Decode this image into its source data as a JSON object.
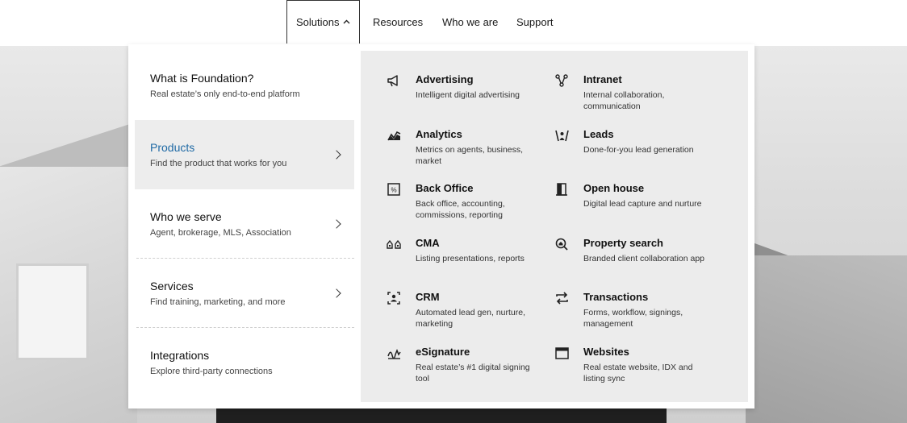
{
  "topnav": {
    "items": [
      {
        "label": "Solutions",
        "active": true
      },
      {
        "label": "Resources"
      },
      {
        "label": "Who we are"
      },
      {
        "label": "Support"
      }
    ]
  },
  "left": {
    "items": [
      {
        "title": "What is Foundation?",
        "subtitle": "Real estate’s only end-to-end platform",
        "arrow": false,
        "selected": false
      },
      {
        "title": "Products",
        "subtitle": "Find the product that works for you",
        "arrow": true,
        "selected": true
      },
      {
        "title": "Who we serve",
        "subtitle": "Agent, brokerage, MLS, Association",
        "arrow": true,
        "selected": false
      },
      {
        "title": "Services",
        "subtitle": "Find training, marketing, and more",
        "arrow": true,
        "selected": false
      },
      {
        "title": "Integrations",
        "subtitle": "Explore third-party connections",
        "arrow": false,
        "selected": false
      }
    ]
  },
  "products": [
    {
      "icon": "megaphone-icon",
      "title": "Advertising",
      "desc": "Intelligent digital advertising"
    },
    {
      "icon": "network-icon",
      "title": "Intranet",
      "desc": "Internal collaboration, communication"
    },
    {
      "icon": "analytics-icon",
      "title": "Analytics",
      "desc": "Metrics on agents, business, market"
    },
    {
      "icon": "leads-icon",
      "title": "Leads",
      "desc": "Done-for-you lead generation"
    },
    {
      "icon": "percent-doc-icon",
      "title": "Back Office",
      "desc": "Back office, accounting, commissions, reporting"
    },
    {
      "icon": "door-icon",
      "title": "Open house",
      "desc": "Digital lead capture and nurture"
    },
    {
      "icon": "compare-icon",
      "title": "CMA",
      "desc": "Listing presentations, reports"
    },
    {
      "icon": "home-search-icon",
      "title": "Property search",
      "desc": "Branded client collaboration app"
    },
    {
      "icon": "contact-icon",
      "title": "CRM",
      "desc": "Automated lead gen, nurture, marketing"
    },
    {
      "icon": "swap-icon",
      "title": "Transactions",
      "desc": "Forms, workflow, signings, management"
    },
    {
      "icon": "signature-icon",
      "title": "eSignature",
      "desc": "Real estate’s #1 digital signing tool"
    },
    {
      "icon": "browser-icon",
      "title": "Websites",
      "desc": "Real estate website, IDX and listing sync"
    }
  ]
}
